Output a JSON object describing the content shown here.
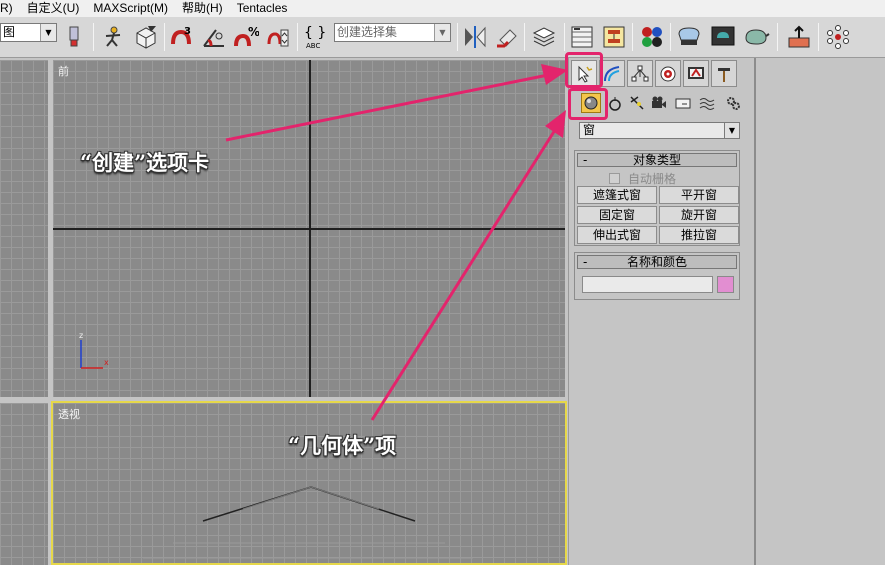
{
  "menu": {
    "items": [
      "R)",
      "自定义(U)",
      "MAXScript(M)",
      "帮助(H)",
      "Tentacles"
    ]
  },
  "toolbar": {
    "view_combo": "图",
    "selection_set_placeholder": "创建选择集",
    "snap_label": "3"
  },
  "viewports": {
    "front_label": "前",
    "perspective_label": "透视",
    "axis_z": "z",
    "axis_x": "x"
  },
  "command_panel": {
    "category_dropdown": "窗",
    "object_type_rollout": {
      "title": "对象类型",
      "collapse_symbol": "-",
      "autogrid_label": "自动栅格",
      "buttons": [
        "遮篷式窗",
        "平开窗",
        "固定窗",
        "旋开窗",
        "伸出式窗",
        "推拉窗"
      ]
    },
    "name_color_rollout": {
      "title": "名称和颜色",
      "collapse_symbol": "-",
      "name_value": "",
      "color": "#e28ed1"
    }
  },
  "annotations": {
    "create_tab": "“创建”选项卡",
    "geometry_item": "“几何体”项",
    "highlight_color": "#e3246c"
  }
}
